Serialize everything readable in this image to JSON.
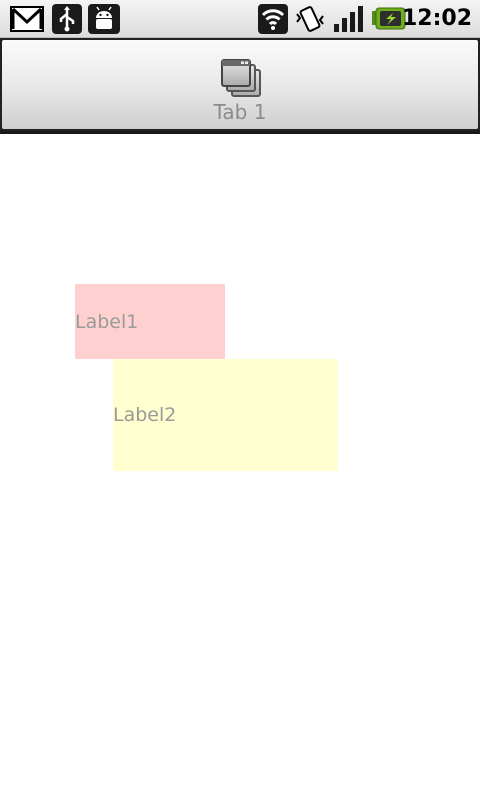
{
  "status_bar": {
    "time": "12:02",
    "icons": [
      "gmail-icon",
      "usb-icon",
      "android-debug-icon",
      "wifi-icon",
      "vibrate-icon",
      "signal-icon",
      "battery-charging-icon"
    ]
  },
  "tabs": [
    {
      "label": "Tab 1",
      "icon": "windows-stack-icon"
    }
  ],
  "content": {
    "label1": "Label1",
    "label2": "Label2",
    "label1_color": "#ffd0d0",
    "label2_color": "#ffffd0"
  }
}
